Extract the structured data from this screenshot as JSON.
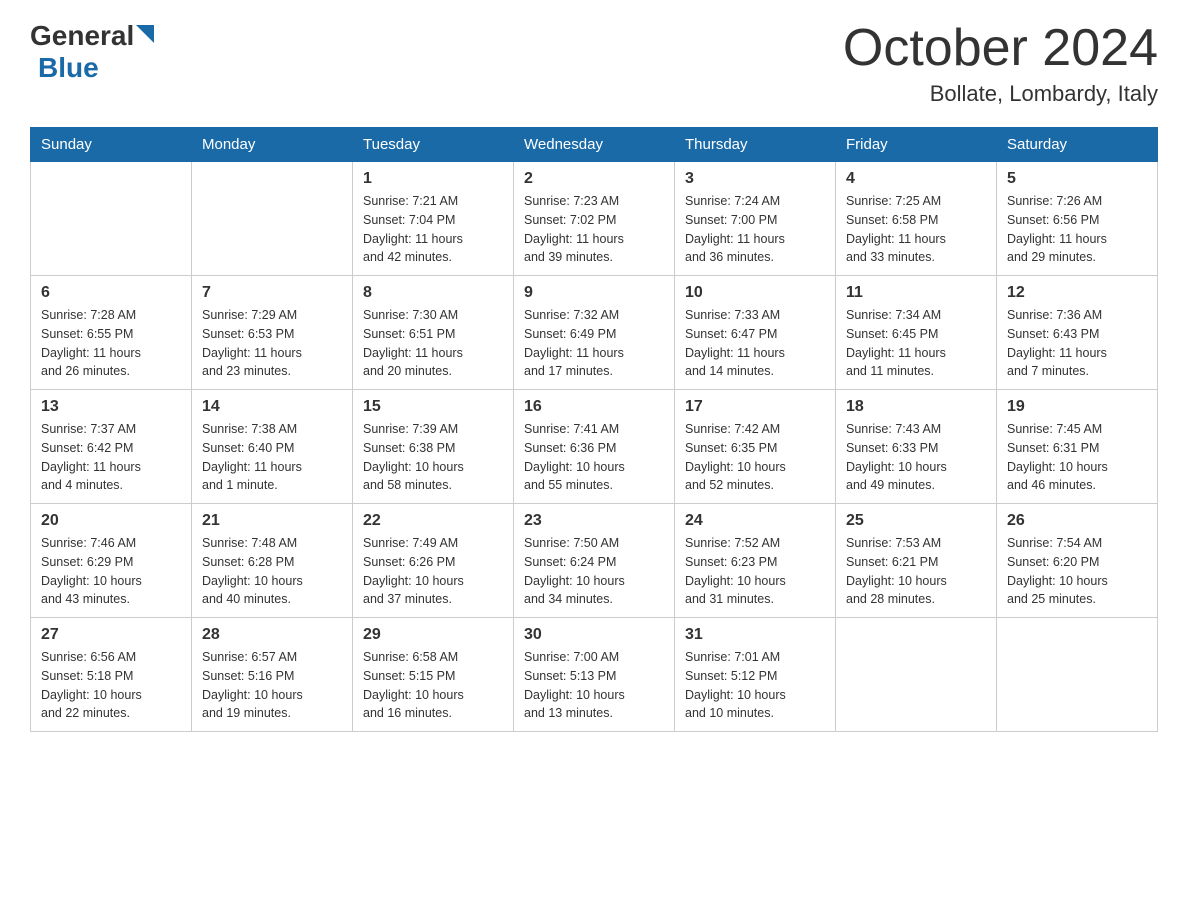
{
  "header": {
    "logo_general": "General",
    "logo_blue": "Blue",
    "month_title": "October 2024",
    "location": "Bollate, Lombardy, Italy"
  },
  "days_of_week": [
    "Sunday",
    "Monday",
    "Tuesday",
    "Wednesday",
    "Thursday",
    "Friday",
    "Saturday"
  ],
  "weeks": [
    [
      {
        "day": "",
        "info": ""
      },
      {
        "day": "",
        "info": ""
      },
      {
        "day": "1",
        "info": "Sunrise: 7:21 AM\nSunset: 7:04 PM\nDaylight: 11 hours\nand 42 minutes."
      },
      {
        "day": "2",
        "info": "Sunrise: 7:23 AM\nSunset: 7:02 PM\nDaylight: 11 hours\nand 39 minutes."
      },
      {
        "day": "3",
        "info": "Sunrise: 7:24 AM\nSunset: 7:00 PM\nDaylight: 11 hours\nand 36 minutes."
      },
      {
        "day": "4",
        "info": "Sunrise: 7:25 AM\nSunset: 6:58 PM\nDaylight: 11 hours\nand 33 minutes."
      },
      {
        "day": "5",
        "info": "Sunrise: 7:26 AM\nSunset: 6:56 PM\nDaylight: 11 hours\nand 29 minutes."
      }
    ],
    [
      {
        "day": "6",
        "info": "Sunrise: 7:28 AM\nSunset: 6:55 PM\nDaylight: 11 hours\nand 26 minutes."
      },
      {
        "day": "7",
        "info": "Sunrise: 7:29 AM\nSunset: 6:53 PM\nDaylight: 11 hours\nand 23 minutes."
      },
      {
        "day": "8",
        "info": "Sunrise: 7:30 AM\nSunset: 6:51 PM\nDaylight: 11 hours\nand 20 minutes."
      },
      {
        "day": "9",
        "info": "Sunrise: 7:32 AM\nSunset: 6:49 PM\nDaylight: 11 hours\nand 17 minutes."
      },
      {
        "day": "10",
        "info": "Sunrise: 7:33 AM\nSunset: 6:47 PM\nDaylight: 11 hours\nand 14 minutes."
      },
      {
        "day": "11",
        "info": "Sunrise: 7:34 AM\nSunset: 6:45 PM\nDaylight: 11 hours\nand 11 minutes."
      },
      {
        "day": "12",
        "info": "Sunrise: 7:36 AM\nSunset: 6:43 PM\nDaylight: 11 hours\nand 7 minutes."
      }
    ],
    [
      {
        "day": "13",
        "info": "Sunrise: 7:37 AM\nSunset: 6:42 PM\nDaylight: 11 hours\nand 4 minutes."
      },
      {
        "day": "14",
        "info": "Sunrise: 7:38 AM\nSunset: 6:40 PM\nDaylight: 11 hours\nand 1 minute."
      },
      {
        "day": "15",
        "info": "Sunrise: 7:39 AM\nSunset: 6:38 PM\nDaylight: 10 hours\nand 58 minutes."
      },
      {
        "day": "16",
        "info": "Sunrise: 7:41 AM\nSunset: 6:36 PM\nDaylight: 10 hours\nand 55 minutes."
      },
      {
        "day": "17",
        "info": "Sunrise: 7:42 AM\nSunset: 6:35 PM\nDaylight: 10 hours\nand 52 minutes."
      },
      {
        "day": "18",
        "info": "Sunrise: 7:43 AM\nSunset: 6:33 PM\nDaylight: 10 hours\nand 49 minutes."
      },
      {
        "day": "19",
        "info": "Sunrise: 7:45 AM\nSunset: 6:31 PM\nDaylight: 10 hours\nand 46 minutes."
      }
    ],
    [
      {
        "day": "20",
        "info": "Sunrise: 7:46 AM\nSunset: 6:29 PM\nDaylight: 10 hours\nand 43 minutes."
      },
      {
        "day": "21",
        "info": "Sunrise: 7:48 AM\nSunset: 6:28 PM\nDaylight: 10 hours\nand 40 minutes."
      },
      {
        "day": "22",
        "info": "Sunrise: 7:49 AM\nSunset: 6:26 PM\nDaylight: 10 hours\nand 37 minutes."
      },
      {
        "day": "23",
        "info": "Sunrise: 7:50 AM\nSunset: 6:24 PM\nDaylight: 10 hours\nand 34 minutes."
      },
      {
        "day": "24",
        "info": "Sunrise: 7:52 AM\nSunset: 6:23 PM\nDaylight: 10 hours\nand 31 minutes."
      },
      {
        "day": "25",
        "info": "Sunrise: 7:53 AM\nSunset: 6:21 PM\nDaylight: 10 hours\nand 28 minutes."
      },
      {
        "day": "26",
        "info": "Sunrise: 7:54 AM\nSunset: 6:20 PM\nDaylight: 10 hours\nand 25 minutes."
      }
    ],
    [
      {
        "day": "27",
        "info": "Sunrise: 6:56 AM\nSunset: 5:18 PM\nDaylight: 10 hours\nand 22 minutes."
      },
      {
        "day": "28",
        "info": "Sunrise: 6:57 AM\nSunset: 5:16 PM\nDaylight: 10 hours\nand 19 minutes."
      },
      {
        "day": "29",
        "info": "Sunrise: 6:58 AM\nSunset: 5:15 PM\nDaylight: 10 hours\nand 16 minutes."
      },
      {
        "day": "30",
        "info": "Sunrise: 7:00 AM\nSunset: 5:13 PM\nDaylight: 10 hours\nand 13 minutes."
      },
      {
        "day": "31",
        "info": "Sunrise: 7:01 AM\nSunset: 5:12 PM\nDaylight: 10 hours\nand 10 minutes."
      },
      {
        "day": "",
        "info": ""
      },
      {
        "day": "",
        "info": ""
      }
    ]
  ]
}
